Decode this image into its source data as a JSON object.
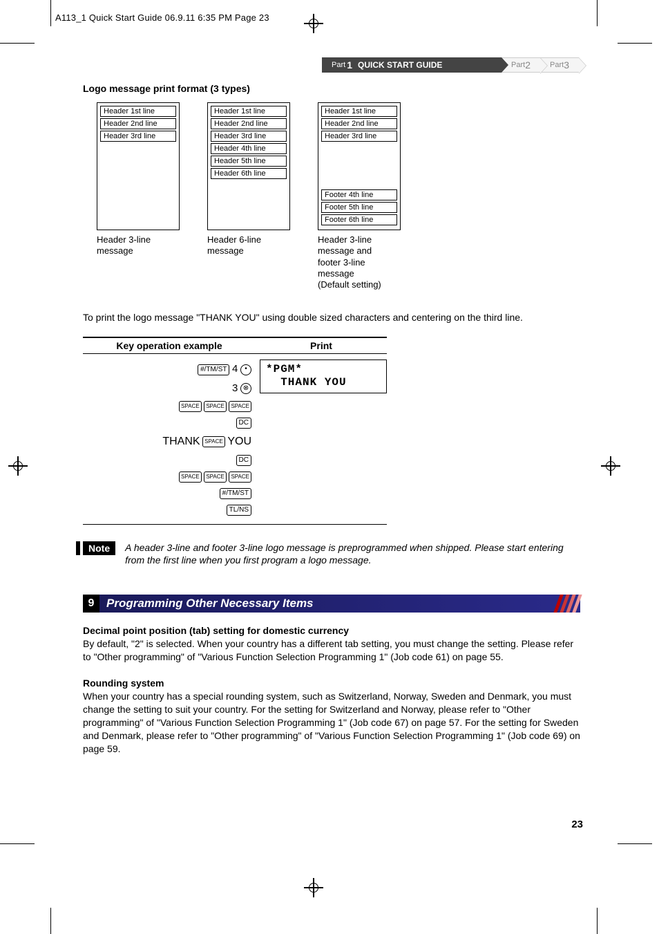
{
  "running_header": "A113_1 Quick Start Guide  06.9.11 6:35 PM  Page 23",
  "tabs": {
    "part_prefix": "Part",
    "current_num": "1",
    "current_title": "QUICK START GUIDE",
    "p2_prefix": "Part",
    "p2_num": "2",
    "p3_prefix": "Part",
    "p3_num": "3"
  },
  "logo_section": {
    "title": "Logo message print format (3 types)",
    "receipts": [
      {
        "lines": [
          "Header 1st line",
          "Header 2nd line",
          "Header 3rd line"
        ],
        "footer": [],
        "caption": "Header 3-line\nmessage"
      },
      {
        "lines": [
          "Header 1st line",
          "Header 2nd line",
          "Header 3rd line",
          "Header 4th line",
          "Header 5th line",
          "Header 6th line"
        ],
        "footer": [],
        "caption": "Header 6-line\nmessage"
      },
      {
        "lines": [
          "Header 1st line",
          "Header 2nd line",
          "Header 3rd line"
        ],
        "footer": [
          "Footer 4th line",
          "Footer 5th line",
          "Footer 6th line"
        ],
        "caption": "Header 3-line\nmessage and\nfooter 3-line\nmessage\n(Default setting)"
      }
    ],
    "intro_para": "To print the logo message \"THANK YOU\" using double sized characters and centering on the third line."
  },
  "kop": {
    "head_left": "Key operation example",
    "head_right": "Print",
    "keys": {
      "tmst": "#/TM/ST",
      "num4": "4",
      "dot": "•",
      "num3": "3",
      "mult": "⊗",
      "space": "SPACE",
      "dc": "DC",
      "thank": "THANK",
      "you": "YOU",
      "tlns": "TL/NS"
    },
    "print_line1": "*PGM*",
    "print_line2": "  THANK YOU"
  },
  "note": {
    "label": "Note",
    "text": "A header 3-line and footer 3-line logo message is preprogrammed when shipped.  Please start entering from the first line when you first program a logo message."
  },
  "section9": {
    "num": "9",
    "title": "Programming Other Necessary Items",
    "decimal_h": "Decimal point position (tab) setting for domestic currency",
    "decimal_p": "By default, \"2\" is selected.  When your country has a different tab setting, you must change the setting.  Please refer to \"Other programming\" of \"Various Function Selection Programming 1\" (Job code 61) on page 55.",
    "round_h": "Rounding system",
    "round_p": "When your country has a special rounding system, such as Switzerland, Norway, Sweden and Denmark, you must change the setting to suit your country. For the setting for Switzerland and Norway, please refer to \"Other programming\" of \"Various Function Selection Programming 1\" (Job code 67) on page 57.  For the setting for Sweden and Denmark, please refer to \"Other programming\" of \"Various Function Selection Programming 1\" (Job code 69) on page 59."
  },
  "page_number": "23"
}
